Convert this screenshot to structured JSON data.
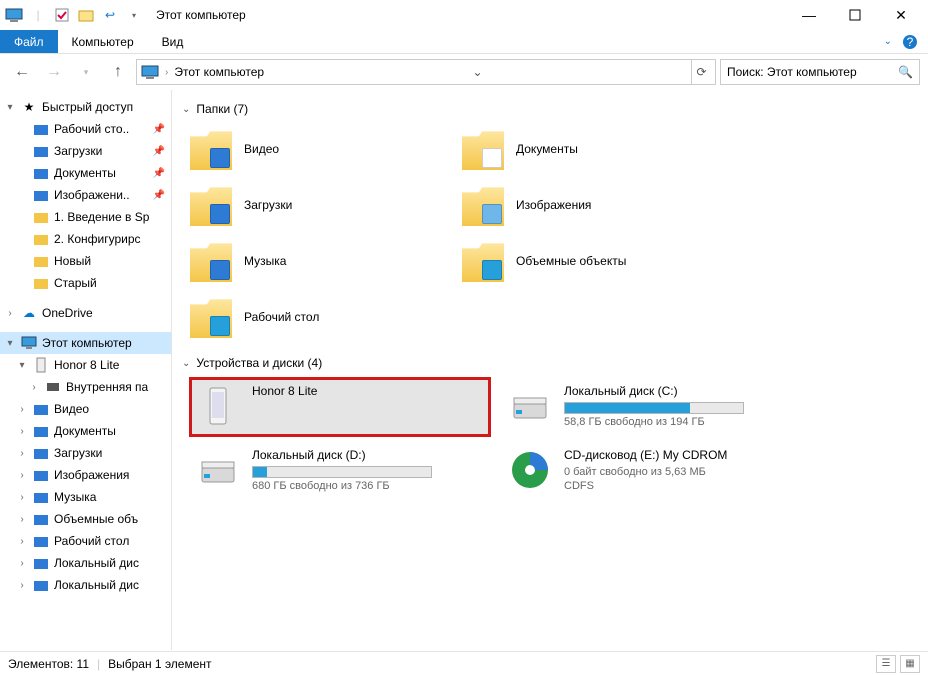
{
  "window": {
    "title": "Этот компьютер"
  },
  "ribbon": {
    "file": "Файл",
    "computer": "Компьютер",
    "view": "Вид"
  },
  "address": {
    "text": "Этот компьютер"
  },
  "search": {
    "placeholder": "Поиск: Этот компьютер"
  },
  "sidebar": {
    "quick": "Быстрый доступ",
    "q_items": [
      {
        "label": "Рабочий сто..",
        "pin": true
      },
      {
        "label": "Загрузки",
        "pin": true
      },
      {
        "label": "Документы",
        "pin": true
      },
      {
        "label": "Изображени..",
        "pin": true
      },
      {
        "label": "1. Введение в Sp",
        "pin": false
      },
      {
        "label": "2. Конфигурирс",
        "pin": false
      },
      {
        "label": "Новый",
        "pin": false
      },
      {
        "label": "Старый",
        "pin": false
      }
    ],
    "onedrive": "OneDrive",
    "thispc": "Этот компьютер",
    "honor": "Honor 8 Lite",
    "internal": "Внутренняя па",
    "pc_children": [
      {
        "label": "Видео"
      },
      {
        "label": "Документы"
      },
      {
        "label": "Загрузки"
      },
      {
        "label": "Изображения"
      },
      {
        "label": "Музыка"
      },
      {
        "label": "Объемные объ"
      },
      {
        "label": "Рабочий стол"
      },
      {
        "label": "Локальный дис"
      },
      {
        "label": "Локальный дис"
      }
    ]
  },
  "groups": {
    "folders_header": "Папки (7)",
    "devices_header": "Устройства и диски (4)"
  },
  "folders": [
    {
      "label": "Видео",
      "badge": "#2e7bd6"
    },
    {
      "label": "Документы",
      "badge": "#ffffff"
    },
    {
      "label": "Загрузки",
      "badge": "#2e7bd6"
    },
    {
      "label": "Изображения",
      "badge": "#6fb7e8"
    },
    {
      "label": "Музыка",
      "badge": "#2e7bd6"
    },
    {
      "label": "Объемные объекты",
      "badge": "#26a0da"
    },
    {
      "label": "Рабочий стол",
      "badge": "#26a0da"
    }
  ],
  "devices": [
    {
      "label": "Honor 8 Lite",
      "type": "phone",
      "highlight": true
    },
    {
      "label": "Локальный диск (C:)",
      "type": "drive",
      "sub": "58,8 ГБ свободно из 194 ГБ",
      "fill": 70
    },
    {
      "label": "Локальный диск (D:)",
      "type": "drive",
      "sub": "680 ГБ свободно из 736 ГБ",
      "fill": 8
    },
    {
      "label": "CD-дисковод (E:) My CDROM",
      "type": "cd",
      "sub": "0 байт свободно из 5,63 МБ",
      "sub2": "CDFS"
    }
  ],
  "status": {
    "items": "Элементов: 11",
    "selected": "Выбран 1 элемент"
  }
}
